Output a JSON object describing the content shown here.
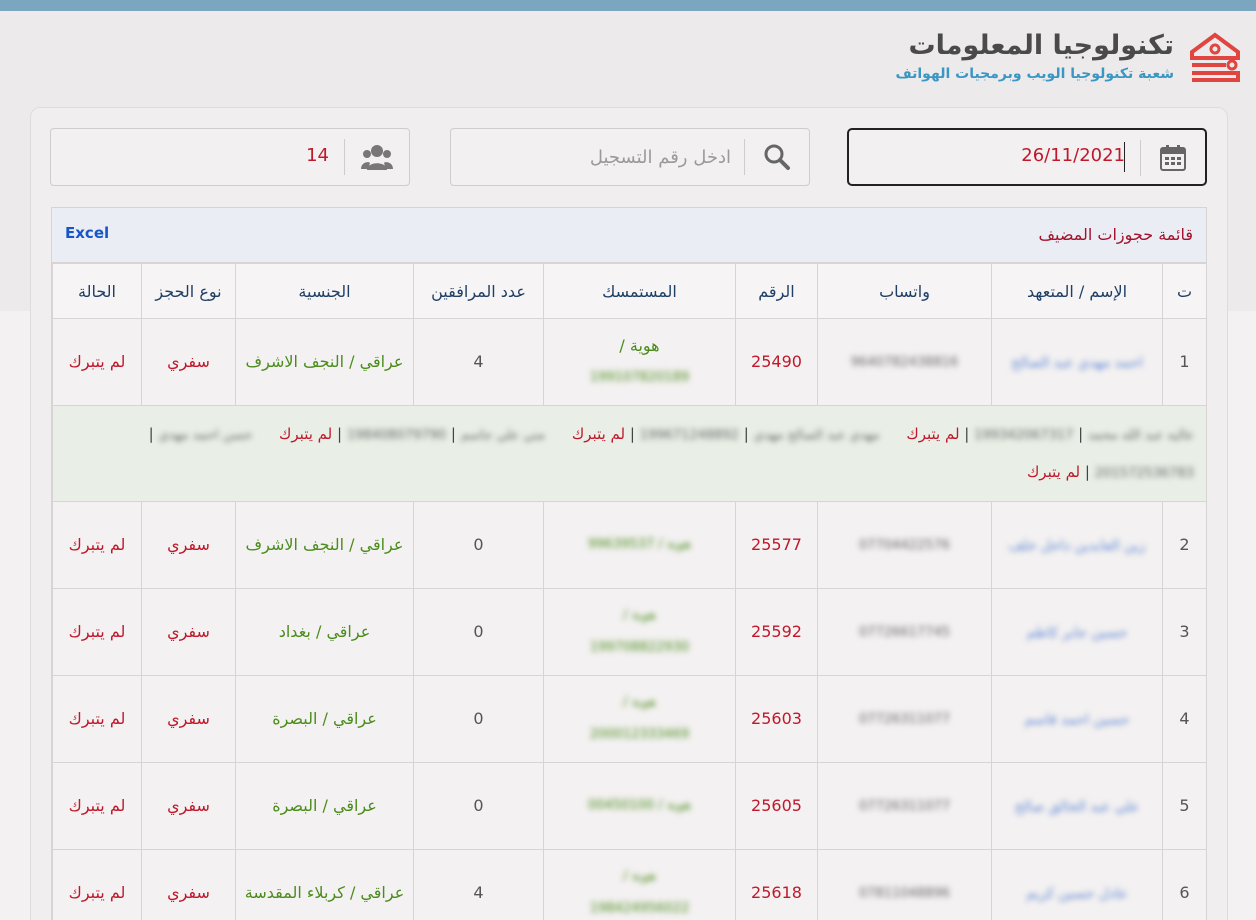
{
  "brand": {
    "title": "تكنولوجيا المعلومات",
    "subtitle": "شعبة تكنولوجيا الويب وبرمجيات الهواتف",
    "colors": {
      "topbar": "#7aa6bf",
      "accent": "#c0182b",
      "link": "#1756c7",
      "green": "#4b8c1c"
    }
  },
  "filters": {
    "date_value": "26/11/2021",
    "date_icon": "calendar-icon",
    "search_placeholder": "ادخل رقم التسجيل",
    "search_icon": "search-icon",
    "count_value": "14",
    "count_icon": "users-icon"
  },
  "table": {
    "title": "قائمة حجوزات المضيف",
    "excel_label": "Excel",
    "columns": [
      "ت",
      "الإسم / المتعهد",
      "واتساب",
      "الرقم",
      "المستمسك",
      "عدد المرافقين",
      "الجنسية",
      "نوع الحجز",
      "الحالة"
    ],
    "rows": [
      {
        "idx": "1",
        "name": "احمد مهدي عبد الصالح",
        "whatsapp": "9640782438816",
        "number": "25490",
        "doc_label": "هوية /",
        "doc_value": "199107820189",
        "companions": "4",
        "nationality": "عراقي / النجف الاشرف",
        "type": "سفري",
        "status": "لم يتبرك"
      },
      {
        "idx": "2",
        "name": "زين العابدين داخل خلف",
        "whatsapp": "07704422576",
        "number": "25577",
        "doc_label": "",
        "doc_value": "هوية / 99639537",
        "companions": "0",
        "nationality": "عراقي / النجف الاشرف",
        "type": "سفري",
        "status": "لم يتبرك"
      },
      {
        "idx": "3",
        "name": "حسين جابر كاظم",
        "whatsapp": "07726617745",
        "number": "25592",
        "doc_label": "هوية /",
        "doc_value": "199708822930",
        "companions": "0",
        "nationality": "عراقي / بغداد",
        "type": "سفري",
        "status": "لم يتبرك"
      },
      {
        "idx": "4",
        "name": "حسين احمد قاسم",
        "whatsapp": "07726311077",
        "number": "25603",
        "doc_label": "هوية /",
        "doc_value": "200012333469",
        "companions": "0",
        "nationality": "عراقي / البصرة",
        "type": "سفري",
        "status": "لم يتبرك"
      },
      {
        "idx": "5",
        "name": "علي عبد الخالق صالح",
        "whatsapp": "07726311077",
        "number": "25605",
        "doc_label": "",
        "doc_value": "هوية / 00450100",
        "companions": "0",
        "nationality": "عراقي / البصرة",
        "type": "سفري",
        "status": "لم يتبرك"
      },
      {
        "idx": "6",
        "name": "عادل حسين كريم",
        "whatsapp": "07811048896",
        "number": "25618",
        "doc_label": "هوية /",
        "doc_value": "198424956022",
        "companions": "4",
        "nationality": "عراقي / كربلاء المقدسة",
        "type": "سفري",
        "status": "لم يتبرك"
      }
    ],
    "companions_row": [
      {
        "name": "عاليه عبد الله محمد",
        "id": "199342067317",
        "status": "لم يتبرك"
      },
      {
        "name": "مهدي عبد الصالح مهدي",
        "id": "199671248892",
        "status": "لم يتبرك"
      },
      {
        "name": "مني علي جاسم",
        "id": "198408079790",
        "status": "لم يتبرك"
      },
      {
        "name": "حسن احمد مهدي",
        "id": "201572536783",
        "status": "لم يتبرك"
      }
    ]
  }
}
